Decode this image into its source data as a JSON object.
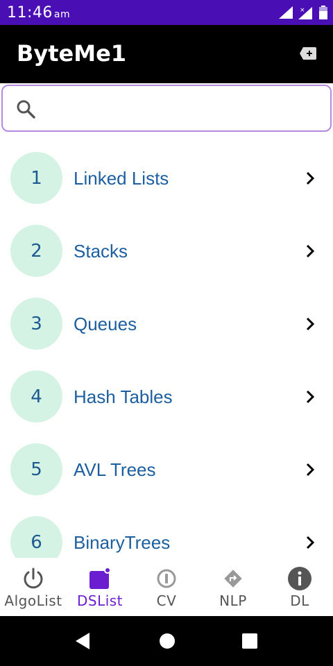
{
  "status_bar": {
    "time": "11:46",
    "ampm": "am",
    "bg_color": "#4a0fb4",
    "icons": [
      "signal-icon",
      "signal-x-icon",
      "battery-icon"
    ]
  },
  "app_bar": {
    "title": "ByteMe1",
    "action_icon": "add-box-icon"
  },
  "search": {
    "placeholder": "",
    "value": "",
    "icon": "search-icon",
    "border_color": "#b48ae0"
  },
  "list": {
    "badge_color": "#d4f3e4",
    "label_color": "#1d5f9e",
    "items": [
      {
        "num": "1",
        "label": "Linked Lists"
      },
      {
        "num": "2",
        "label": "Stacks"
      },
      {
        "num": "3",
        "label": "Queues"
      },
      {
        "num": "4",
        "label": "Hash Tables"
      },
      {
        "num": "5",
        "label": "AVL Trees"
      },
      {
        "num": "6",
        "label": "BinaryTrees"
      }
    ]
  },
  "bottom_nav": {
    "active_color": "#6a1ed0",
    "items": [
      {
        "label": "AlgoList",
        "icon": "power-icon",
        "active": false
      },
      {
        "label": "DSList",
        "icon": "square-badge-icon",
        "active": true
      },
      {
        "label": "CV",
        "icon": "pause-circle-icon",
        "active": false
      },
      {
        "label": "NLP",
        "icon": "directions-icon",
        "active": false
      },
      {
        "label": "DL",
        "icon": "info-icon",
        "active": false
      }
    ]
  },
  "system_nav": {
    "buttons": [
      "back-icon",
      "home-icon",
      "recents-icon"
    ]
  }
}
